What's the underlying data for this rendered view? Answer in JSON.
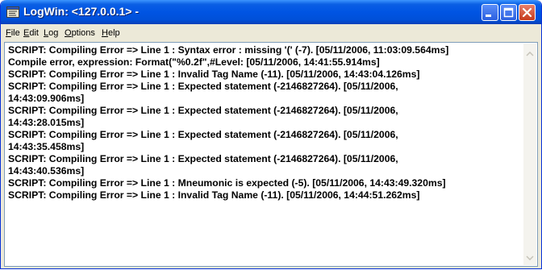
{
  "window": {
    "title": "LogWin: <127.0.0.1> -",
    "icon": "logwin-app-icon",
    "controls": [
      "minimize-icon",
      "maximize-icon",
      "close-icon"
    ],
    "accent_color": "#0054e3"
  },
  "menu": {
    "items": [
      {
        "label": "File",
        "accel": "F",
        "rest": "ile"
      },
      {
        "label": "Edit",
        "accel": "E",
        "rest": "dit"
      },
      {
        "label": "Log",
        "accel": "L",
        "rest": "og"
      },
      {
        "label": "Options",
        "accel": "O",
        "rest": "ptions"
      },
      {
        "label": "Help",
        "accel": "H",
        "rest": "elp"
      }
    ]
  },
  "log": {
    "lines": [
      "SCRIPT: Compiling Error => Line 1 : Syntax error : missing '(' (-7). [05/11/2006, 11:03:09.564ms]",
      "Compile error, expression: Format(\"%0.2f\",#Level: [05/11/2006, 14:41:55.914ms]",
      "SCRIPT: Compiling Error => Line 1 : Invalid Tag Name (-11). [05/11/2006, 14:43:04.126ms]",
      "SCRIPT: Compiling Error => Line 1 : Expected statement (-2146827264). [05/11/2006,",
      "14:43:09.906ms]",
      "SCRIPT: Compiling Error => Line 1 : Expected statement (-2146827264). [05/11/2006,",
      "14:43:28.015ms]",
      "SCRIPT: Compiling Error => Line 1 : Expected statement (-2146827264). [05/11/2006,",
      "14:43:35.458ms]",
      "SCRIPT: Compiling Error => Line 1 : Expected statement (-2146827264). [05/11/2006,",
      "14:43:40.536ms]",
      "SCRIPT: Compiling Error => Line 1 : Mneumonic is expected (-5). [05/11/2006, 14:43:49.320ms]",
      "SCRIPT: Compiling Error => Line 1 : Invalid Tag Name (-11). [05/11/2006, 14:44:51.262ms]"
    ]
  }
}
